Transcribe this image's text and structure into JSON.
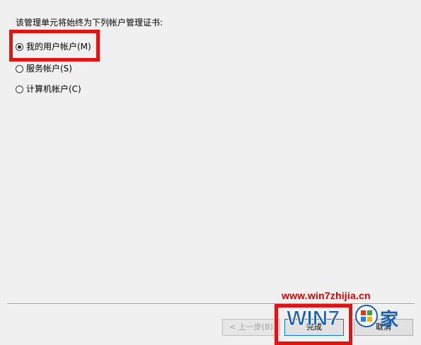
{
  "dialog": {
    "prompt": "该管理单元将始终为下列帐户管理证书:",
    "options": [
      {
        "label": "我的用户帐户(M)",
        "checked": true
      },
      {
        "label": "服务帐户(S)",
        "checked": false
      },
      {
        "label": "计算机帐户(C)",
        "checked": false
      }
    ],
    "buttons": {
      "back": "< 上一步(B)",
      "finish": "完成",
      "cancel": "取消"
    }
  },
  "watermark": {
    "url": "www.win7zhijia.cn",
    "logo_text": "WIN7之家"
  },
  "colors": {
    "highlight": "#e01414",
    "background": "#f0f0f0"
  }
}
